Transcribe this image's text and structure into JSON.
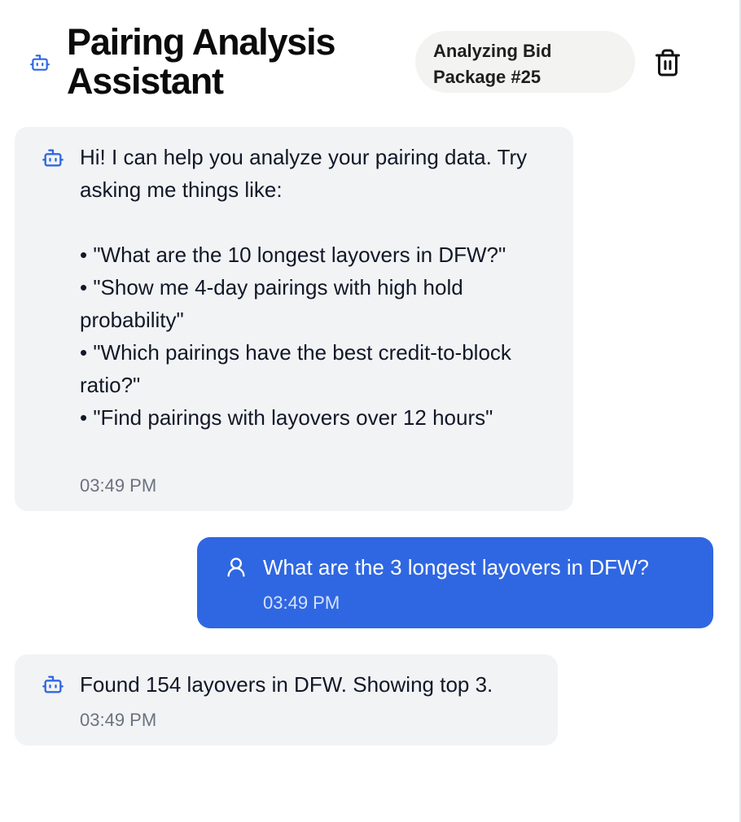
{
  "header": {
    "title": "Pairing Analysis Assistant",
    "title_icon": "robot-icon",
    "package_badge": "Analyzing Bid\nPackage #25",
    "delete_icon": "trash-icon"
  },
  "messages": [
    {
      "role": "assistant",
      "icon": "robot-icon",
      "text": "Hi! I can help you analyze your pairing data. Try asking me things like:\n\n• \"What are the 10 longest layovers in DFW?\"\n• \"Show me 4-day pairings with high hold probability\"\n• \"Which pairings have the best credit-to-block ratio?\"\n• \"Find pairings with layovers over 12 hours\"",
      "time": "03:49 PM"
    },
    {
      "role": "user",
      "icon": "user-icon",
      "text": "What are the 3 longest layovers in DFW?",
      "time": "03:49 PM"
    },
    {
      "role": "assistant",
      "icon": "robot-icon",
      "text": "Found 154 layovers in DFW. Showing top 3.",
      "time": "03:49 PM"
    }
  ],
  "colors": {
    "accent_blue": "#2f67e2",
    "assistant_bubble": "#f2f3f5",
    "badge_background": "#f3f3f1",
    "timestamp_gray": "#6b7280"
  }
}
